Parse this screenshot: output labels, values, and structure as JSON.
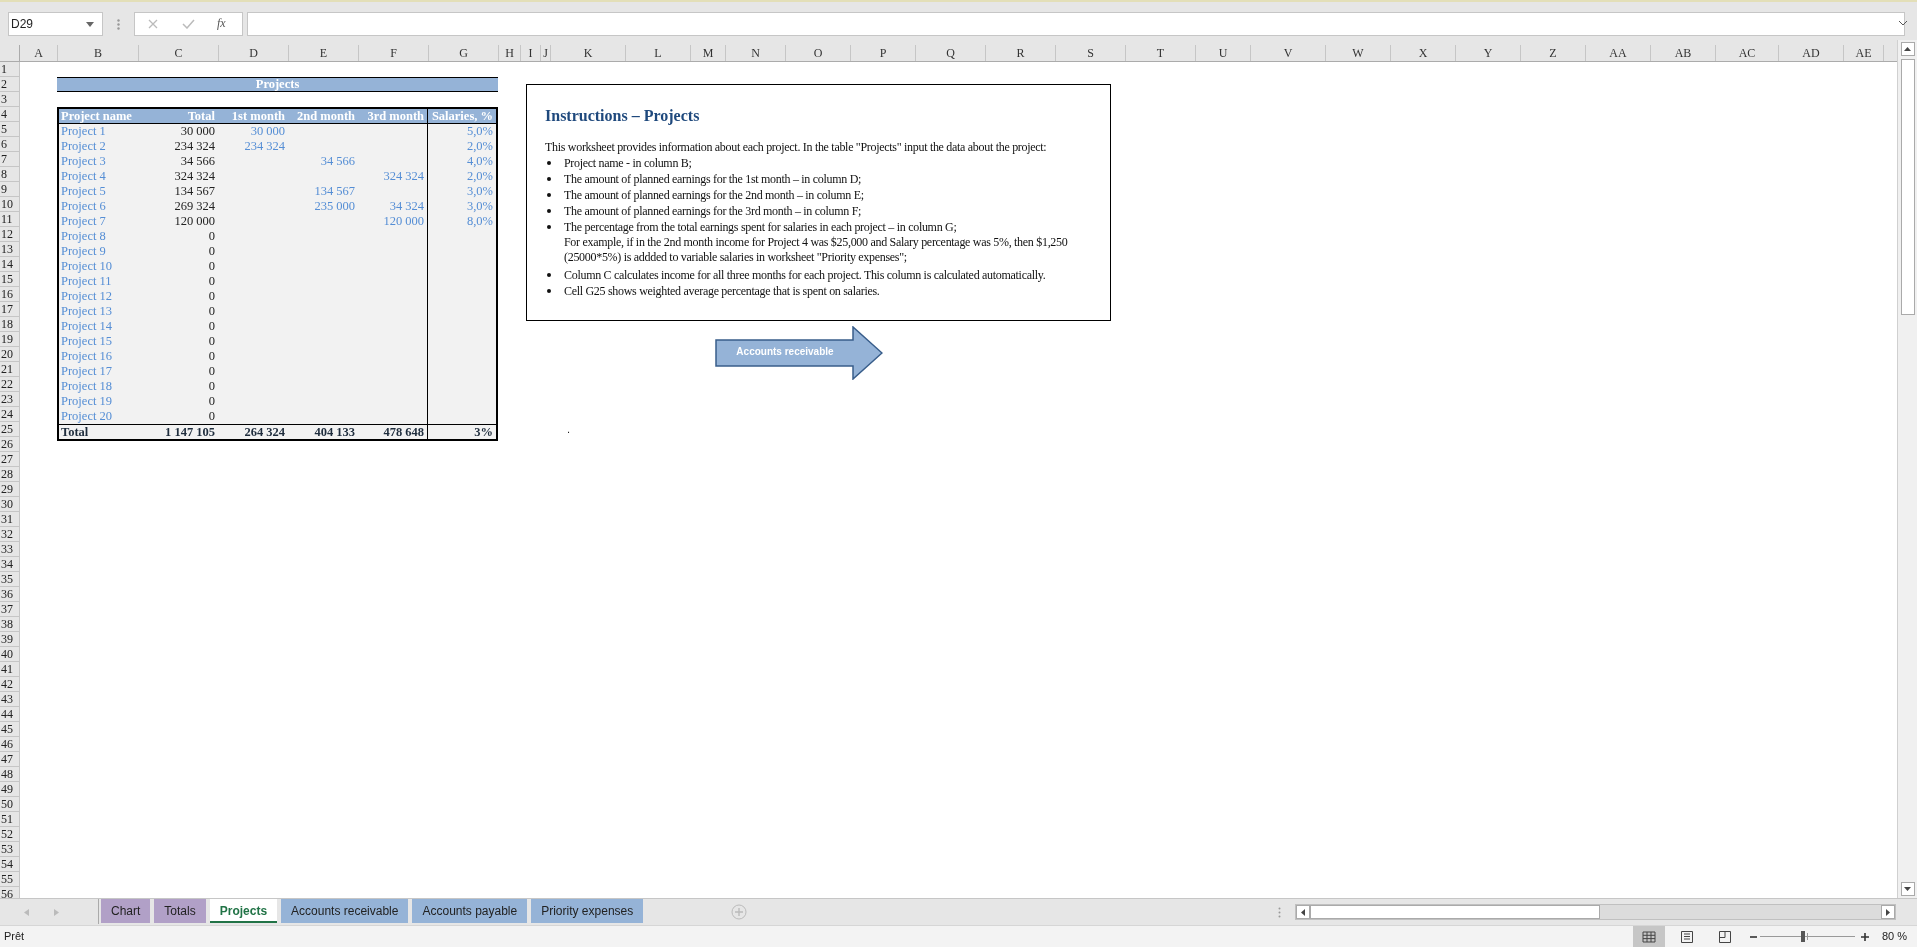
{
  "name_box": {
    "value": "D29"
  },
  "formula_bar": {
    "function_label": "fx"
  },
  "columns": [
    "A",
    "B",
    "C",
    "D",
    "E",
    "F",
    "G",
    "H",
    "I",
    "J",
    "K",
    "L",
    "M",
    "N",
    "O",
    "P",
    "Q",
    "R",
    "S",
    "T",
    "U",
    "V",
    "W",
    "X",
    "Y",
    "Z",
    "AA",
    "AB",
    "AC",
    "AD",
    "AE"
  ],
  "rows": [
    "1",
    "2",
    "3",
    "4",
    "5",
    "6",
    "7",
    "8",
    "9",
    "10",
    "11",
    "12",
    "13",
    "14",
    "15",
    "16",
    "17",
    "18",
    "19",
    "20",
    "21",
    "22",
    "23",
    "24",
    "25",
    "26",
    "27",
    "28",
    "29",
    "30",
    "31",
    "32",
    "33",
    "34",
    "35",
    "36",
    "37",
    "38",
    "39",
    "40",
    "41",
    "42",
    "43",
    "44",
    "45",
    "46",
    "47",
    "48",
    "49",
    "50",
    "51",
    "52",
    "53",
    "54",
    "55",
    "56"
  ],
  "table": {
    "title": "Projects",
    "columns": [
      "Project name",
      "Total",
      "1st month",
      "2nd month",
      "3rd month",
      "Salaries, %"
    ],
    "rows": [
      {
        "name": "Project 1",
        "total": "30 000",
        "month_1": "30 000",
        "salaries": "5,0%"
      },
      {
        "name": "Project 2",
        "total": "234 324",
        "month_1": "234 324",
        "salaries": "2,0%"
      },
      {
        "name": "Project 3",
        "total": "34 566",
        "month_2": "34 566",
        "salaries": "4,0%"
      },
      {
        "name": "Project 4",
        "total": "324 324",
        "month_3": "324 324",
        "salaries": "2,0%"
      },
      {
        "name": "Project 5",
        "total": "134 567",
        "month_2": "134 567",
        "salaries": "3,0%"
      },
      {
        "name": "Project 6",
        "total": "269 324",
        "month_2": "235 000",
        "month_3": "34 324",
        "salaries": "3,0%"
      },
      {
        "name": "Project 7",
        "total": "120 000",
        "month_3": "120 000",
        "salaries": "8,0%"
      },
      {
        "name": "Project 8",
        "total": "0"
      },
      {
        "name": "Project 9",
        "total": "0"
      },
      {
        "name": "Project 10",
        "total": "0"
      },
      {
        "name": "Project 11",
        "total": "0"
      },
      {
        "name": "Project 12",
        "total": "0"
      },
      {
        "name": "Project 13",
        "total": "0"
      },
      {
        "name": "Project 14",
        "total": "0"
      },
      {
        "name": "Project 15",
        "total": "0"
      },
      {
        "name": "Project 16",
        "total": "0"
      },
      {
        "name": "Project 17",
        "total": "0"
      },
      {
        "name": "Project 18",
        "total": "0"
      },
      {
        "name": "Project 19",
        "total": "0"
      },
      {
        "name": "Project 20",
        "total": "0"
      }
    ],
    "total": {
      "name": "Total",
      "total": "1 147 105",
      "month_1": "264 324",
      "month_2": "404 133",
      "month_3": "478 648",
      "salaries": "3%"
    }
  },
  "instructions": {
    "title": "Instructions – Projects",
    "intro": "This worksheet provides information about each project. In the table \"Projects\" input the data about the project:",
    "bullets": [
      {
        "text": "Project name - in column B;"
      },
      {
        "text": "The amount of planned earnings for the 1st month – in column D;"
      },
      {
        "text": "The amount of planned earnings for the 2nd month – in column E;"
      },
      {
        "text": "The amount of planned earnings for the 3rd month – in column F;"
      },
      {
        "text": "The percentage from the total earnings spent for salaries in each project – in column G;",
        "note": "For example, if in the 2nd month income for Project 4  was $25,000 and Salary percentage was 5%, then $1,250 (25000*5%) is addded to variable salaries in worksheet \"Priority expenses\";"
      },
      {
        "text": "Column C calculates income for all three months for each project. This column is calculated automatically."
      },
      {
        "text": "Cell G25 shows weighted average percentage that is spent on salaries."
      }
    ]
  },
  "link_arrow": {
    "label": "Accounts receivable"
  },
  "stray_mark": ".",
  "sheet_tabs": [
    {
      "label": "Chart",
      "color": "#b1a0c7",
      "selected": false
    },
    {
      "label": "Totals",
      "color": "#b1a0c7",
      "selected": false
    },
    {
      "label": "Projects",
      "selected": true
    },
    {
      "label": "Accounts receivable",
      "color": "#95b3d7",
      "selected": false
    },
    {
      "label": "Accounts payable",
      "color": "#95b3d7",
      "selected": false
    },
    {
      "label": "Priority expenses",
      "color": "#95b3d7",
      "selected": false
    }
  ],
  "status_bar": {
    "status": "Prêt",
    "views": [
      {
        "kind": "normal",
        "selected": true
      },
      {
        "kind": "page_layout",
        "selected": false
      },
      {
        "kind": "page_break",
        "selected": false
      }
    ],
    "zoom": {
      "level": 0.45,
      "reading": "80 %"
    }
  }
}
